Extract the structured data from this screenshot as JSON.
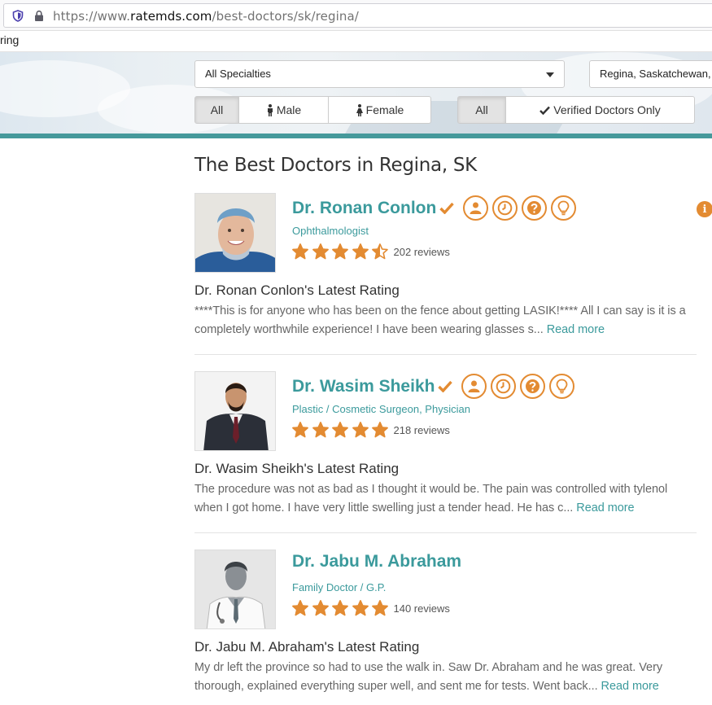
{
  "browser": {
    "url_prefix": "https://www.",
    "url_domain": "ratemds.com",
    "url_path": "/best-doctors/sk/regina/",
    "tab_fragment": "ring"
  },
  "filters": {
    "specialty_selected": "All Specialties",
    "location_value": "Regina, Saskatchewan, Ca",
    "gender": [
      "All",
      "Male",
      "Female"
    ],
    "verified": [
      "All",
      "Verified Doctors Only"
    ]
  },
  "page_title": "The Best Doctors in Regina, SK",
  "doctors": [
    {
      "name": "Dr. Ronan Conlon",
      "verified": true,
      "badges": [
        "person-icon",
        "clock-icon",
        "question-icon",
        "lightbulb-icon"
      ],
      "specialty": "Ophthalmologist",
      "rating": 4.5,
      "reviews": "202 reviews",
      "latest_title": "Dr. Ronan Conlon's Latest Rating",
      "latest_text": "****This is for anyone who has been on the fence about getting LASIK!**** All I can say is it is a completely worthwhile experience! I have been wearing glasses s...",
      "read_more": "Read more"
    },
    {
      "name": "Dr. Wasim Sheikh",
      "verified": true,
      "badges": [
        "person-icon",
        "clock-icon",
        "question-icon",
        "lightbulb-icon"
      ],
      "specialty": "Plastic / Cosmetic Surgeon, Physician",
      "rating": 5,
      "reviews": "218 reviews",
      "latest_title": "Dr. Wasim Sheikh's Latest Rating",
      "latest_text": "The procedure was not as bad as I thought it would be. The pain was controlled with tylenol when I got home. I have very little swelling just a tender head. He has c...",
      "read_more": "Read more"
    },
    {
      "name": "Dr. Jabu M. Abraham",
      "verified": false,
      "badges": [],
      "specialty": "Family Doctor / G.P.",
      "rating": 5,
      "reviews": "140 reviews",
      "latest_title": "Dr. Jabu M. Abraham's Latest Rating",
      "latest_text": "My dr left the province so had to use the walk in. Saw Dr. Abraham and he was great. Very thorough, explained everything super well, and sent me for tests. Went back...",
      "read_more": "Read more"
    }
  ],
  "colors": {
    "accent": "#3b9a9c",
    "star": "#e38b32",
    "teal_bar": "#45999b"
  }
}
